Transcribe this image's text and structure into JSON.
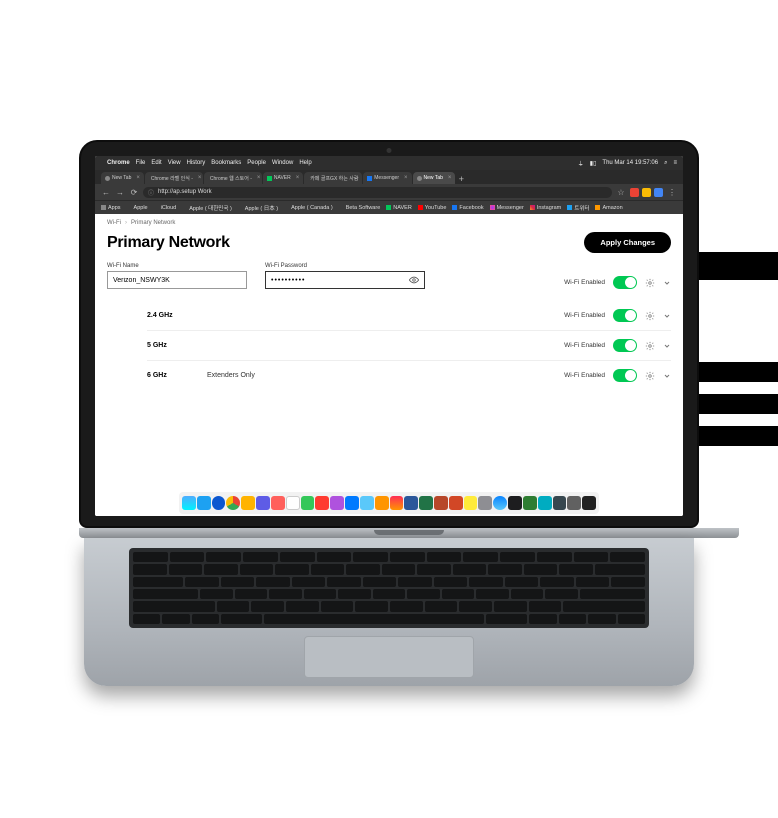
{
  "menubar": {
    "app": "Chrome",
    "items": [
      "File",
      "Edit",
      "View",
      "History",
      "Bookmarks",
      "People",
      "Window",
      "Help"
    ],
    "clock": "Thu Mar 14 19:57:06"
  },
  "tabs": [
    {
      "label": "New Tab",
      "fav": "blank"
    },
    {
      "label": "Chrome 라벨 인식 - ",
      "fav": "chrome"
    },
    {
      "label": "Chrome 웹 스토어 - ",
      "fav": "chrome"
    },
    {
      "label": "NAVER",
      "fav": "naver"
    },
    {
      "label": "카페 골프GX 하는 사람",
      "fav": "naver"
    },
    {
      "label": "Messenger",
      "fav": "fb"
    },
    {
      "label": "New Tab",
      "fav": "blank",
      "active": true
    }
  ],
  "url": "http://ap.setup Work",
  "bookmarks": [
    {
      "label": "Apps",
      "icon": "grid"
    },
    {
      "label": "Apple",
      "icon": "apple"
    },
    {
      "label": "iCloud",
      "icon": "apple"
    },
    {
      "label": "Apple ( 대한민국 )",
      "icon": "apple"
    },
    {
      "label": "Apple ( 日本 )",
      "icon": "apple"
    },
    {
      "label": "Apple ( Canada )",
      "icon": "apple"
    },
    {
      "label": "Beta Software",
      "icon": "apple"
    },
    {
      "label": "NAVER",
      "icon": "naver"
    },
    {
      "label": "YouTube",
      "icon": "yt"
    },
    {
      "label": "Facebook",
      "icon": "fb"
    },
    {
      "label": "Messenger",
      "icon": "msg"
    },
    {
      "label": "Instagram",
      "icon": "ig"
    },
    {
      "label": "트위터",
      "icon": "tw"
    },
    {
      "label": "Amazon",
      "icon": "az"
    }
  ],
  "breadcrumb": {
    "root": "Wi-Fi",
    "current": "Primary Network"
  },
  "page": {
    "title": "Primary Network",
    "apply": "Apply Changes"
  },
  "fields": {
    "name_label": "Wi-Fi Name",
    "name_value": "Verizon_NSWY3K",
    "password_label": "Wi-Fi Password",
    "password_mask": "••••••••••",
    "enabled_label": "Wi-Fi Enabled"
  },
  "bands": [
    {
      "name": "2.4 GHz",
      "sub": "",
      "enabled_label": "Wi-Fi Enabled"
    },
    {
      "name": "5 GHz",
      "sub": "",
      "enabled_label": "Wi-Fi Enabled"
    },
    {
      "name": "6 GHz",
      "sub": "Extenders Only",
      "enabled_label": "Wi-Fi Enabled"
    }
  ]
}
